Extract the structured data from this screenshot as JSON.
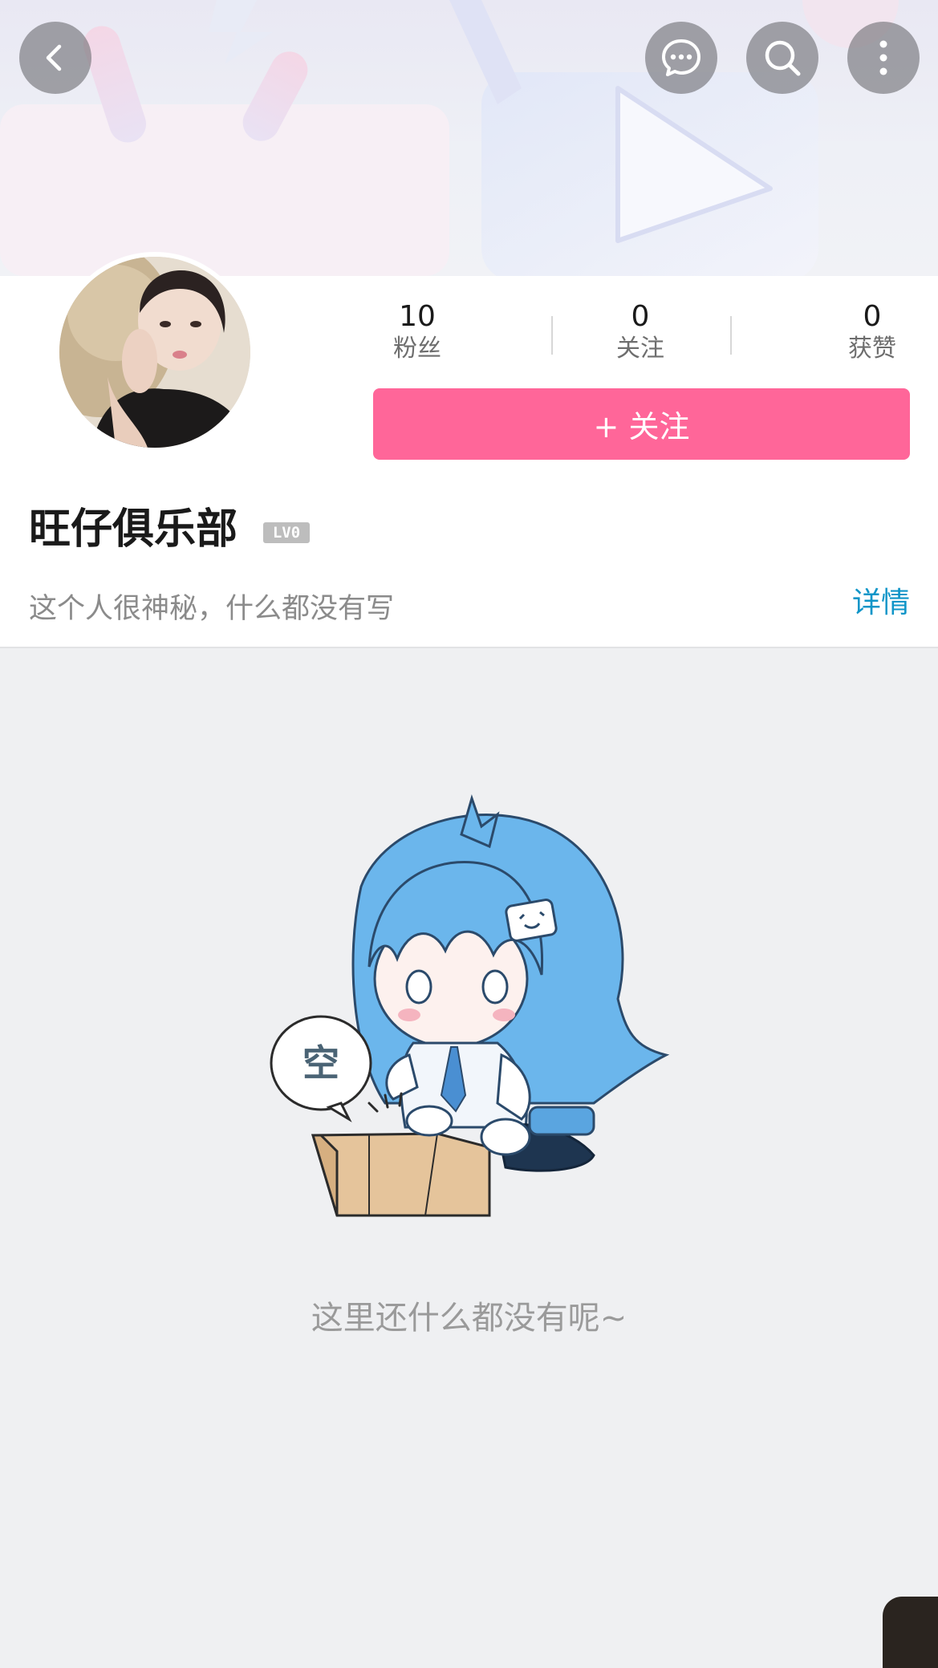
{
  "nav": {
    "back_icon": "chevron-left-icon",
    "message_icon": "chat-bubble-icon",
    "search_icon": "search-icon",
    "more_icon": "more-vertical-icon"
  },
  "stats": [
    {
      "value": "10",
      "label": "粉丝"
    },
    {
      "value": "0",
      "label": "关注"
    },
    {
      "value": "0",
      "label": "获赞"
    }
  ],
  "follow_button": "+ 关注",
  "user": {
    "name": "旺仔俱乐部",
    "level": "LV0",
    "signature": "这个人很神秘，什么都没有写",
    "detail_link": "详情"
  },
  "empty_state": {
    "bubble_text": "空",
    "message": "这里还什么都没有呢~"
  },
  "colors": {
    "accent": "#ff6699",
    "link": "#0f95c8",
    "background": "#eff0f2"
  }
}
